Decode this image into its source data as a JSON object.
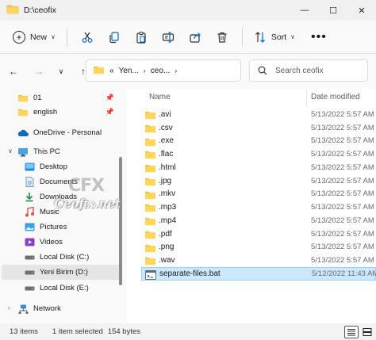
{
  "window": {
    "title": "D:\\ceofix",
    "minimize": "—",
    "maximize": "☐",
    "close": "✕"
  },
  "toolbar": {
    "new_label": "New",
    "sort_label": "Sort",
    "more_label": "•••"
  },
  "address": {
    "overflow": "«",
    "crumbs": [
      "Yen...",
      "ceo..."
    ],
    "search_placeholder": "Search ceofix"
  },
  "sidebar": {
    "items": [
      {
        "label": "01",
        "icon": "folder-icon",
        "pinned": true
      },
      {
        "label": "english",
        "icon": "folder-icon",
        "pinned": true
      },
      {
        "label": "OneDrive - Personal",
        "icon": "cloud-icon"
      },
      {
        "label": "This PC",
        "icon": "computer-icon"
      },
      {
        "label": "Desktop",
        "icon": "desktop-icon"
      },
      {
        "label": "Documents",
        "icon": "documents-icon"
      },
      {
        "label": "Downloads",
        "icon": "download-icon"
      },
      {
        "label": "Music",
        "icon": "music-icon"
      },
      {
        "label": "Pictures",
        "icon": "pictures-icon"
      },
      {
        "label": "Videos",
        "icon": "videos-icon"
      },
      {
        "label": "Local Disk (C:)",
        "icon": "drive-icon"
      },
      {
        "label": "Yeni Birim (D:)",
        "icon": "drive-icon",
        "selected": true
      },
      {
        "label": "Local Disk (E:)",
        "icon": "drive-icon"
      },
      {
        "label": "Network",
        "icon": "network-icon"
      }
    ]
  },
  "file_list": {
    "columns": [
      "Name",
      "Date modified"
    ],
    "rows": [
      {
        "name": ".avi",
        "date": "5/13/2022 5:57 AM",
        "type": "folder"
      },
      {
        "name": ".csv",
        "date": "5/13/2022 5:57 AM",
        "type": "folder"
      },
      {
        "name": ".exe",
        "date": "5/13/2022 5:57 AM",
        "type": "folder"
      },
      {
        "name": ".flac",
        "date": "5/13/2022 5:57 AM",
        "type": "folder"
      },
      {
        "name": ".html",
        "date": "5/13/2022 5:57 AM",
        "type": "folder"
      },
      {
        "name": ".jpg",
        "date": "5/13/2022 5:57 AM",
        "type": "folder"
      },
      {
        "name": ".mkv",
        "date": "5/13/2022 5:57 AM",
        "type": "folder"
      },
      {
        "name": ".mp3",
        "date": "5/13/2022 5:57 AM",
        "type": "folder"
      },
      {
        "name": ".mp4",
        "date": "5/13/2022 5:57 AM",
        "type": "folder"
      },
      {
        "name": ".pdf",
        "date": "5/13/2022 5:57 AM",
        "type": "folder"
      },
      {
        "name": ".png",
        "date": "5/13/2022 5:57 AM",
        "type": "folder"
      },
      {
        "name": ".wav",
        "date": "5/13/2022 5:57 AM",
        "type": "folder"
      },
      {
        "name": "separate-files.bat",
        "date": "5/12/2022 11:43 AM",
        "type": "bat",
        "selected": true
      }
    ]
  },
  "status": {
    "count": "13 items",
    "selection": "1 item selected",
    "size": "154 bytes"
  },
  "watermark": {
    "logo": "CFX",
    "site": "Ceofix.net"
  },
  "colors": {
    "folder": "#f5c242",
    "selection": "#cce8ff",
    "accent": "#0067c0"
  }
}
